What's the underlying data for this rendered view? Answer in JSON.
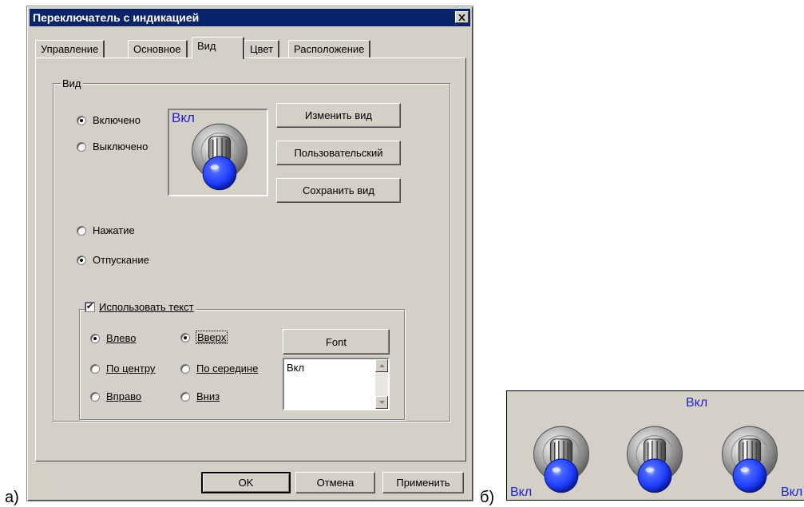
{
  "captions": {
    "a": "а)",
    "b": "б)"
  },
  "dialog": {
    "title": "Переключатель с индикацией",
    "tabs": [
      "Управление",
      "Основное",
      "Вид",
      "Цвет",
      "Расположение"
    ],
    "active_tab": "Вид",
    "view_group": {
      "label": "Вид",
      "state_on": "Включено",
      "state_off": "Выключено",
      "press": "Нажатие",
      "release": "Отпускание",
      "preview_text": "Вкл",
      "change_view_button": "Изменить вид",
      "custom_button": "Пользовательский",
      "save_view_button": "Сохранить вид"
    },
    "text_group": {
      "checkbox_label": "Использовать текст",
      "checked": true,
      "left": "Влево",
      "center": "По центру",
      "right": "Вправо",
      "top": "Вверх",
      "middle": "По середине",
      "bottom": "Вниз",
      "font_button": "Font",
      "text_value": "Вкл"
    },
    "footer": {
      "ok": "OK",
      "cancel": "Отмена",
      "apply": "Применить"
    }
  },
  "preview_panel": {
    "labels": [
      "Вкл",
      "Вкл",
      "Вкл"
    ]
  },
  "colors": {
    "titlebar": "#0a246a",
    "face": "#d4d0c8",
    "accent_text": "#2222cc",
    "bulb": "#1f3fff"
  }
}
